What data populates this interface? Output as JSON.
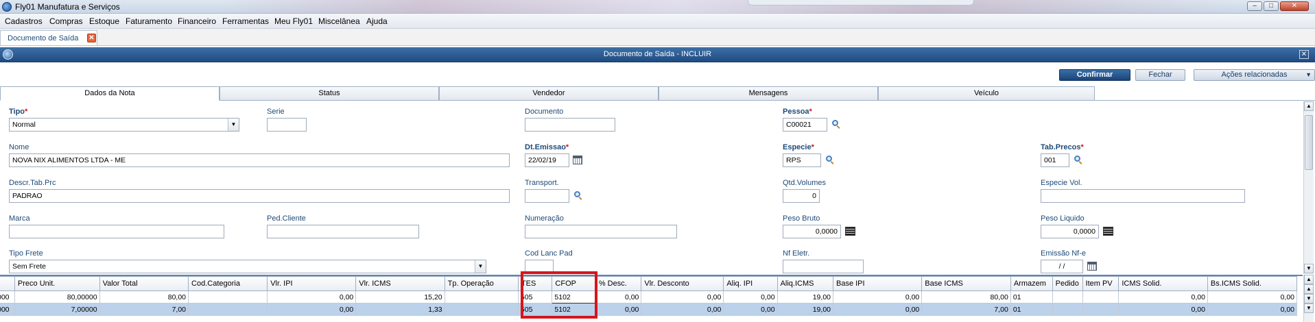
{
  "window": {
    "title": "Fly01 Manufatura e Serviços",
    "controls": {
      "minimize": "–",
      "maximize": "□",
      "close": "✕"
    }
  },
  "menu": [
    "Cadastros",
    "Compras",
    "Estoque",
    "Faturamento",
    "Financeiro",
    "Ferramentas",
    "Meu Fly01",
    "Miscelânea",
    "Ajuda"
  ],
  "doc_tab": {
    "label": "Documento de Saída",
    "close": "✕"
  },
  "dialog": {
    "title": "Documento de Saída - INCLUIR",
    "close": "✕"
  },
  "actions": {
    "confirm": "Confirmar",
    "close": "Fechar",
    "related": "Ações relacionadas",
    "related_caret": "▼"
  },
  "tabs": [
    "Dados da Nota",
    "Status",
    "Vendedor",
    "Mensagens",
    "Veículo"
  ],
  "form": {
    "tipo": {
      "label": "Tipo",
      "value": "Normal"
    },
    "serie": {
      "label": "Serie",
      "value": ""
    },
    "documento": {
      "label": "Documento",
      "value": ""
    },
    "pessoa": {
      "label": "Pessoa",
      "value": "C00021"
    },
    "nome": {
      "label": "Nome",
      "value": "NOVA NIX ALIMENTOS LTDA - ME"
    },
    "dt_emissao": {
      "label": "Dt.Emissao",
      "value": "22/02/19"
    },
    "especie": {
      "label": "Especie",
      "value": "RPS"
    },
    "tab_precos": {
      "label": "Tab.Precos",
      "value": "001"
    },
    "descr_tab_prc": {
      "label": "Descr.Tab.Prc",
      "value": "PADRAO"
    },
    "transport": {
      "label": "Transport.",
      "value": ""
    },
    "qtd_volumes": {
      "label": "Qtd.Volumes",
      "value": "0"
    },
    "especie_vol": {
      "label": "Especie Vol.",
      "value": ""
    },
    "marca": {
      "label": "Marca",
      "value": ""
    },
    "ped_cliente": {
      "label": "Ped.Cliente",
      "value": ""
    },
    "numeracao": {
      "label": "Numeração",
      "value": ""
    },
    "peso_bruto": {
      "label": "Peso Bruto",
      "value": "0,0000"
    },
    "peso_liquido": {
      "label": "Peso Liquido",
      "value": "0,0000"
    },
    "tipo_frete": {
      "label": "Tipo Frete",
      "value": "Sem Frete"
    },
    "cod_lanc_pad": {
      "label": "Cod Lanc Pad",
      "value": ""
    },
    "nf_eletr": {
      "label": "Nf Eletr.",
      "value": ""
    },
    "emissao_nfe": {
      "label": "Emissão Nf-e",
      "value": "/  /"
    }
  },
  "grid": {
    "columns": [
      "",
      "Preco Unit.",
      "Valor Total",
      "Cod.Categoria",
      "Vlr. IPI",
      "Vlr. ICMS",
      "Tp. Operação",
      "TES",
      "CFOP",
      "% Desc.",
      "Vlr. Desconto",
      "Aliq. IPI",
      "Aliq.ICMS",
      "Base IPI",
      "Base ICMS",
      "Armazem",
      "Pedido",
      "Item PV",
      "ICMS Solid.",
      "Bs.ICMS Solid."
    ],
    "rows": [
      [
        "000",
        "80,00000",
        "80,00",
        "",
        "0,00",
        "15,20",
        "",
        "505",
        "5102",
        "0,00",
        "0,00",
        "0,00",
        "19,00",
        "0,00",
        "80,00",
        "01",
        "",
        "",
        "0,00",
        "0,00"
      ],
      [
        "000",
        "7,00000",
        "7,00",
        "",
        "0,00",
        "1,33",
        "",
        "505",
        "5102",
        "0,00",
        "0,00",
        "0,00",
        "19,00",
        "0,00",
        "7,00",
        "01",
        "",
        "",
        "0,00",
        "0,00"
      ]
    ]
  },
  "colors": {
    "highlight": "#d8141b",
    "header": "#1f4c82",
    "selected_row": "#bcd1ea"
  }
}
